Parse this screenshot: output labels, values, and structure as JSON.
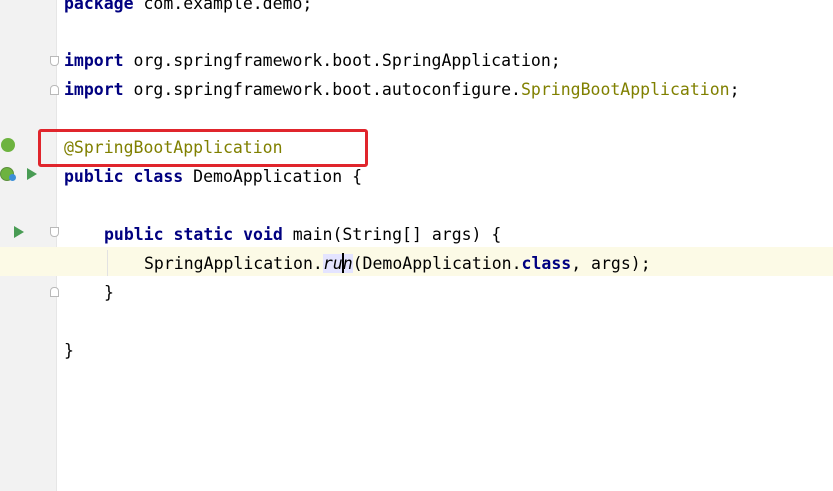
{
  "editor": {
    "lines": {
      "l1": {
        "kw": "package",
        "rest": " com.example.demo;"
      },
      "l2": {
        "kw": "import",
        "rest": " org.springframework.boot.SpringApplication;"
      },
      "l3": {
        "kw": "import",
        "rest_a": " org.springframework.boot.autoconfigure.",
        "ann": "SpringBootApplication",
        "rest_b": ";"
      },
      "l4": {
        "ann": "@SpringBootApplication"
      },
      "l5": {
        "kw": "public class",
        "rest": " DemoApplication {"
      },
      "l6": {
        "kw": "public static void",
        "rest": " main(String[] args) {"
      },
      "l7": {
        "pre": "SpringApplication.",
        "hl_a": "ru",
        "hl_b": "n",
        "mid": "(DemoApplication.",
        "kw": "class",
        "post": ", args);"
      },
      "l8": {
        "text": "}"
      },
      "l9": {
        "text": "}"
      }
    }
  },
  "colors": {
    "keyword": "#000080",
    "annotation": "#808000",
    "highlight_box": "#e0252c",
    "current_line": "#fcfae6",
    "run_icon": "#499c54"
  },
  "icons": {
    "gutter": [
      "spring-bean-icon",
      "spring-boot-run-icon",
      "run-icon",
      "fold-icon"
    ]
  }
}
